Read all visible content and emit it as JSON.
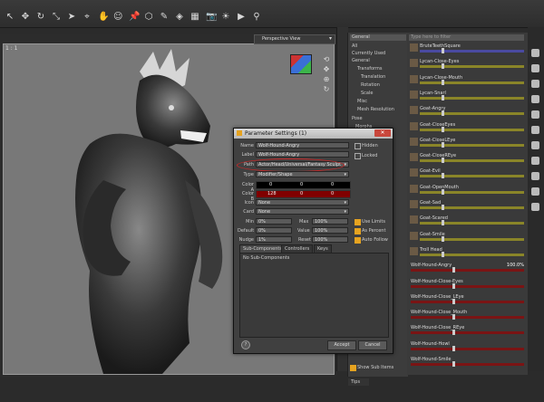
{
  "toolbar": {
    "icons": [
      "pointer-icon",
      "move-icon",
      "rotate-icon",
      "scale-icon",
      "cursor-icon",
      "joint-icon",
      "hand-icon",
      "people-icon",
      "pin-icon",
      "node-icon",
      "paint-icon",
      "geometry-icon",
      "surface-icon",
      "camera-icon",
      "light-icon",
      "render-icon",
      "pose-icon"
    ]
  },
  "viewport": {
    "view_label": "Perspective View",
    "frame_label": "1 : 1"
  },
  "param_tree": {
    "header": "General",
    "items": [
      "All",
      "Currently Used",
      "General",
      "Transforms",
      "Translation",
      "Rotation",
      "Scale",
      "Misc",
      "Mesh Resolution",
      "Pose",
      "Morphs"
    ]
  },
  "param_list": {
    "filter_placeholder": "Type here to filter",
    "items": [
      {
        "label": "BruteTeethSquare"
      },
      {
        "label": "Lycan-Close-Eyes"
      },
      {
        "label": "Lycan-Close-Mouth"
      },
      {
        "label": "Lycan-Snarl"
      },
      {
        "label": "Goat-Angry"
      },
      {
        "label": "Goat-CloseEyes"
      },
      {
        "label": "Goat-CloseLEye"
      },
      {
        "label": "Goat-CloseREye"
      },
      {
        "label": "Goat-Evil"
      },
      {
        "label": "Goat-OpenMouth"
      },
      {
        "label": "Goat-Sad"
      },
      {
        "label": "Goat-Scared"
      },
      {
        "label": "Goat-Smile"
      },
      {
        "label": "Troll Head"
      },
      {
        "label": "Wolf-Hound-Angry",
        "value": "100.0%"
      },
      {
        "label": "Wolf-Hound-Close-Eyes"
      },
      {
        "label": "Wolf-Hound-Close_LEye"
      },
      {
        "label": "Wolf-Hound-Close_Mouth"
      },
      {
        "label": "Wolf-Hound-Close_REye"
      },
      {
        "label": "Wolf-Hound-Howl"
      },
      {
        "label": "Wolf-Hound-Smile"
      }
    ],
    "show_sub_items": "Show Sub Items",
    "tips_label": "Tips"
  },
  "dialog": {
    "title": "Parameter Settings (1)",
    "close_label": "✕",
    "name_label": "Name",
    "name_value": "Wolf-Hound-Angry",
    "label_label": "Label",
    "label_value": "Wolf-Hound-Angry",
    "path_label": "Path",
    "path_value": "Actor/Head/Universal/Fantasy Sculpt",
    "type_label": "Type",
    "type_value": "Modifier/Shape",
    "hidden_label": "Hidden",
    "locked_label": "Locked",
    "color_a_label": "Color A",
    "color_a_values": [
      "0",
      "0",
      "0"
    ],
    "color_b_label": "Color B",
    "color_b_values": [
      "128",
      "0",
      "0"
    ],
    "icon_label": "Icon",
    "icon_value": "None",
    "card_label": "Card",
    "card_value": "None",
    "min_label": "Min",
    "min_value": "0%",
    "max_label": "Max",
    "max_value": "100%",
    "default_label": "Default",
    "default_value": "0%",
    "value_label": "Value",
    "value_value": "100%",
    "nudge_label": "Nudge",
    "nudge_value": "1%",
    "reset_label": "Reset",
    "reset_value": "100%",
    "use_limits": "Use Limits",
    "as_percent": "As Percent",
    "auto_follow": "Auto Follow",
    "tabs": [
      "Sub-Components",
      "Controllers",
      "Keys"
    ],
    "sub_components_text": "No Sub-Components",
    "help_label": "?",
    "accept_label": "Accept",
    "cancel_label": "Cancel"
  },
  "colors": {
    "accent_orange": "#e6a320",
    "highlight_red": "#c62828",
    "close_red": "#c9473c",
    "slider_yellow": "#8a8528",
    "slider_red": "#7a1414"
  }
}
